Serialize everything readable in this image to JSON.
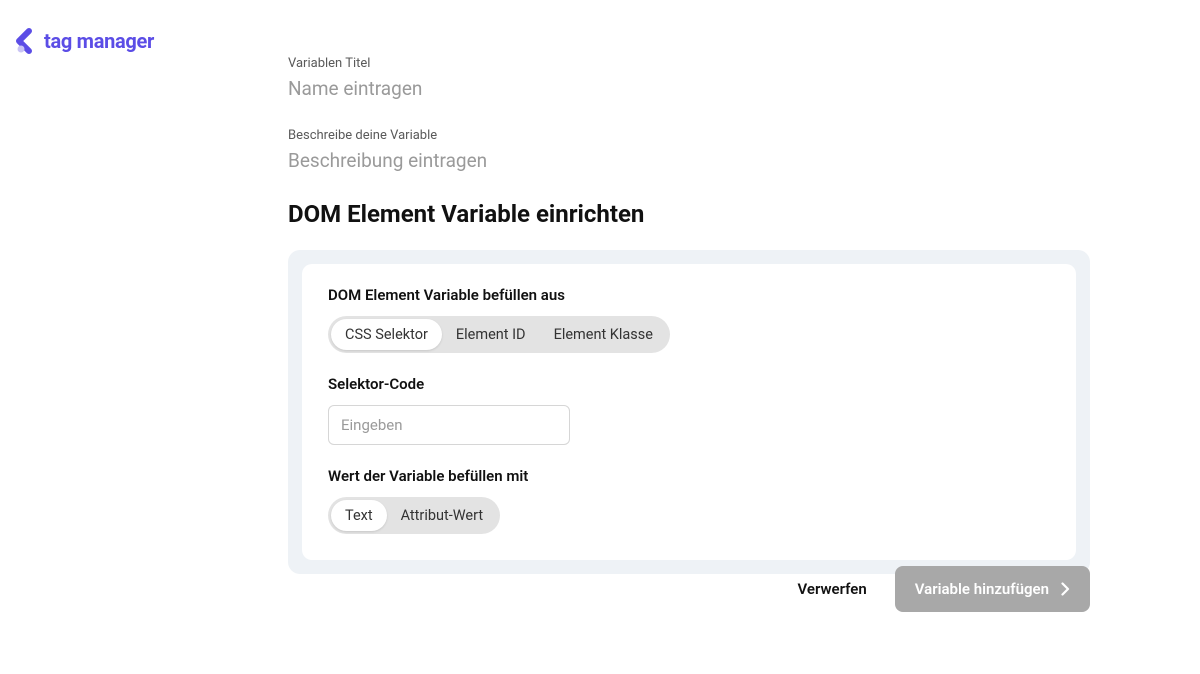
{
  "brand": {
    "name_1": "tag",
    "name_2": "manager"
  },
  "fields": {
    "title_label": "Variablen Titel",
    "title_placeholder": "Name eintragen",
    "desc_label": "Beschreibe deine Variable",
    "desc_placeholder": "Beschreibung eintragen"
  },
  "section": {
    "heading": "DOM Element Variable einrichten"
  },
  "config": {
    "source_label": "DOM Element Variable befüllen aus",
    "source_options": {
      "css": "CSS Selektor",
      "id": "Element ID",
      "class": "Element Klasse"
    },
    "selector_label": "Selektor-Code",
    "selector_placeholder": "Eingeben",
    "value_label": "Wert der Variable befüllen mit",
    "value_options": {
      "text": "Text",
      "attr": "Attribut-Wert"
    }
  },
  "actions": {
    "discard": "Verwerfen",
    "submit": "Variable hinzufügen"
  }
}
